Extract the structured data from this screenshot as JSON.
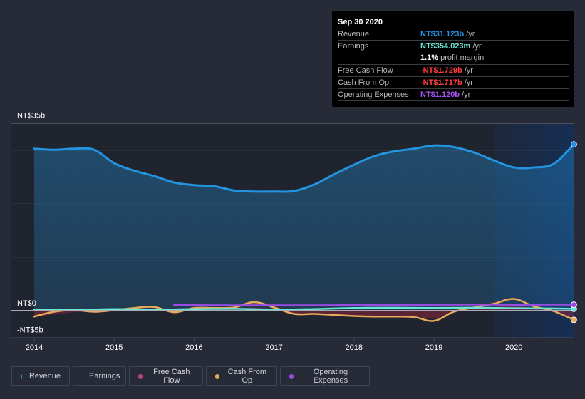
{
  "tooltip": {
    "date": "Sep 30 2020",
    "rows": [
      {
        "label": "Revenue",
        "value": "NT$31.123b",
        "unit": "/yr",
        "color": "#2394df"
      },
      {
        "label": "Earnings",
        "value": "NT$354.023m",
        "unit": "/yr",
        "color": "#6ce5d6",
        "sub_value": "1.1%",
        "sub_text": "profit margin"
      },
      {
        "label": "Free Cash Flow",
        "value": "-NT$1.729b",
        "unit": "/yr",
        "color": "#ff4040"
      },
      {
        "label": "Cash From Op",
        "value": "-NT$1.717b",
        "unit": "/yr",
        "color": "#ff4040"
      },
      {
        "label": "Operating Expenses",
        "value": "NT$1.120b",
        "unit": "/yr",
        "color": "#a855f7"
      }
    ]
  },
  "legend": [
    {
      "label": "Revenue",
      "color": "#2394df"
    },
    {
      "label": "Earnings",
      "color": "#6ce5d6"
    },
    {
      "label": "Free Cash Flow",
      "color": "#c4417f"
    },
    {
      "label": "Cash From Op",
      "color": "#e9a95b"
    },
    {
      "label": "Operating Expenses",
      "color": "#9b4ae6"
    }
  ],
  "chart_data": {
    "type": "area",
    "title": "",
    "xlabel": "",
    "ylabel": "",
    "currency": "NT$",
    "ylim": [
      -5,
      35
    ],
    "xlim": [
      2013.7,
      2020.75
    ],
    "y_tick_labels": [
      "NT$35b",
      "NT$0",
      "-NT$5b"
    ],
    "y_ticks": [
      35,
      0,
      -5
    ],
    "gridlines": [
      30,
      20,
      10
    ],
    "x_tick_labels": [
      "2014",
      "2015",
      "2016",
      "2017",
      "2018",
      "2019",
      "2020"
    ],
    "x_ticks": [
      2014,
      2015,
      2016,
      2017,
      2018,
      2019,
      2020
    ],
    "highlight_from": 2019.75,
    "grid": true,
    "legend_position": "bottom-left",
    "series": [
      {
        "name": "Revenue",
        "unit": "b",
        "color": "#2394df",
        "fill": true,
        "x": [
          2014.0,
          2014.25,
          2014.5,
          2014.75,
          2015.0,
          2015.25,
          2015.5,
          2015.75,
          2016.0,
          2016.25,
          2016.5,
          2016.75,
          2017.0,
          2017.25,
          2017.5,
          2017.75,
          2018.0,
          2018.25,
          2018.5,
          2018.75,
          2019.0,
          2019.25,
          2019.5,
          2019.75,
          2020.0,
          2020.25,
          2020.5,
          2020.75
        ],
        "values": [
          30.3,
          30.1,
          30.3,
          30.1,
          27.6,
          26.2,
          25.2,
          24.0,
          23.5,
          23.3,
          22.5,
          22.3,
          22.3,
          22.4,
          23.6,
          25.5,
          27.3,
          28.9,
          29.8,
          30.3,
          30.9,
          30.6,
          29.6,
          28.1,
          26.8,
          26.8,
          27.5,
          31.1
        ]
      },
      {
        "name": "Earnings",
        "unit": "b",
        "color": "#6ce5d6",
        "fill": false,
        "x": [
          2014.0,
          2014.5,
          2015.0,
          2015.5,
          2016.0,
          2016.5,
          2017.0,
          2017.5,
          2018.0,
          2018.5,
          2019.0,
          2019.5,
          2020.0,
          2020.5,
          2020.75
        ],
        "values": [
          0.25,
          0.15,
          0.3,
          0.2,
          0.3,
          0.35,
          0.2,
          0.3,
          0.5,
          0.55,
          0.5,
          0.55,
          0.45,
          0.4,
          0.35
        ]
      },
      {
        "name": "Free Cash Flow",
        "unit": "b",
        "color": "#c4417f",
        "fill": true,
        "x": [
          2014.0,
          2014.5,
          2015.0,
          2015.5,
          2016.0,
          2016.5,
          2016.75,
          2017.0,
          2017.25,
          2017.5,
          2018.0,
          2018.5,
          2018.75,
          2019.0,
          2019.25,
          2019.5,
          2019.75,
          2020.0,
          2020.25,
          2020.5,
          2020.75
        ],
        "values": [
          -1.2,
          -0.3,
          0.0,
          0.3,
          0.2,
          0.3,
          0.6,
          0.2,
          -0.6,
          -0.7,
          -0.9,
          -1.0,
          -1.0,
          -1.5,
          -0.2,
          0.6,
          0.7,
          1.0,
          0.4,
          -0.2,
          -1.73
        ]
      },
      {
        "name": "Cash From Op",
        "unit": "b",
        "color": "#e9a95b",
        "fill": false,
        "x": [
          2014.0,
          2014.25,
          2014.5,
          2014.75,
          2015.0,
          2015.25,
          2015.5,
          2015.75,
          2016.0,
          2016.25,
          2016.5,
          2016.75,
          2017.0,
          2017.25,
          2017.5,
          2017.75,
          2018.0,
          2018.25,
          2018.5,
          2018.75,
          2019.0,
          2019.25,
          2019.5,
          2019.75,
          2020.0,
          2020.25,
          2020.5,
          2020.75
        ],
        "values": [
          -1.1,
          -0.2,
          0.1,
          -0.2,
          0.1,
          0.5,
          0.7,
          -0.3,
          0.5,
          0.5,
          0.6,
          1.6,
          0.6,
          -0.6,
          -0.6,
          -0.8,
          -1.0,
          -1.1,
          -1.1,
          -1.2,
          -1.9,
          -0.2,
          0.6,
          1.3,
          2.2,
          0.8,
          -0.1,
          -1.72
        ]
      },
      {
        "name": "Operating Expenses",
        "unit": "b",
        "color": "#9b4ae6",
        "fill": false,
        "x": [
          2015.75,
          2016.5,
          2017.0,
          2017.5,
          2018.0,
          2018.5,
          2019.0,
          2019.5,
          2020.0,
          2020.5,
          2020.75
        ],
        "values": [
          1.05,
          1.0,
          1.0,
          1.0,
          1.05,
          1.1,
          1.1,
          1.15,
          1.1,
          1.15,
          1.12
        ]
      }
    ]
  }
}
